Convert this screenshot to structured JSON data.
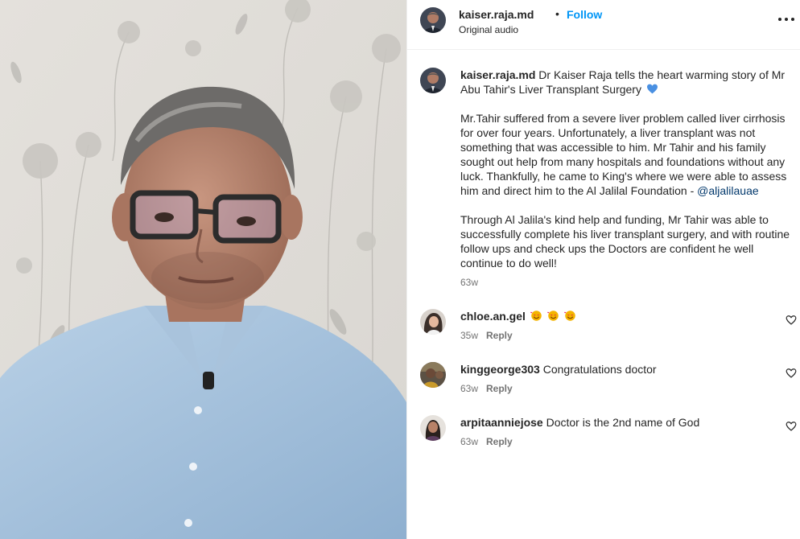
{
  "post": {
    "username": "kaiser.raja.md",
    "dot": "•",
    "follow_label": "Follow",
    "audio_label": "Original audio"
  },
  "caption": {
    "username": "kaiser.raja.md",
    "headline": "Dr Kaiser Raja tells the heart warming story of Mr Abu Tahir's Liver Transplant Surgery",
    "paragraph_2": "Mr.Tahir suffered from a severe liver problem called liver cirrhosis for over four years. Unfortunately, a liver transplant was not something that was accessible to him. Mr Tahir and his family sought out help from many hospitals and foundations without any luck. Thankfully, he came to King's where we were able to assess him and direct him to the Al Jalilal Foundation -",
    "mention": "@aljalilauae",
    "paragraph_3": "Through Al Jalila's kind help and funding, Mr Tahir was able to successfully complete his liver transplant surgery, and with routine follow ups and check ups the Doctors are confident he well continue to do well!",
    "time": "63w",
    "heart_icon": "blue-heart-emoji"
  },
  "comments": [
    {
      "username": "chloe.an.gel",
      "text": "",
      "emoji": "smiling-face-with-hearts",
      "emoji_count": 3,
      "time": "35w",
      "reply_label": "Reply"
    },
    {
      "username": "kinggeorge303",
      "text": "Congratulations doctor",
      "time": "63w",
      "reply_label": "Reply"
    },
    {
      "username": "arpitaanniejose",
      "text": "Doctor is the 2nd name of God",
      "time": "63w",
      "reply_label": "Reply"
    }
  ],
  "colors": {
    "link_blue": "#0095f6",
    "mention_blue": "#00376b",
    "muted": "#737373",
    "text": "#262626",
    "heart_blue": "#4a90e2"
  },
  "icons": [
    "more-options-icon",
    "like-heart-icon",
    "blue-heart-emoji",
    "smiling-face-with-hearts-emoji"
  ]
}
